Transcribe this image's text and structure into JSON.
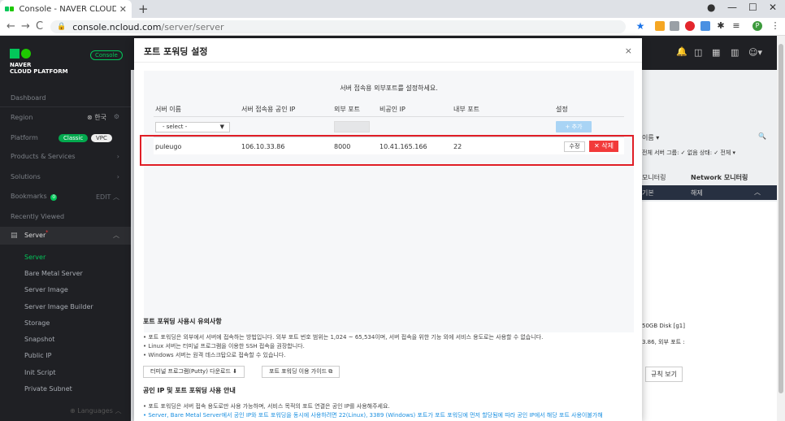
{
  "browser": {
    "tab_title": "Console - NAVER CLOUD PLATF",
    "url_host": "console.ncloud.com",
    "url_path": "/server/server",
    "new_tab": "+",
    "tab_close": "✕",
    "back": "←",
    "forward": "→",
    "reload": "C",
    "minimize": "—",
    "maximize": "☐",
    "close": "✕",
    "profile_initial": "P"
  },
  "sidebar": {
    "logo_line1": "NAVER",
    "logo_line2": "CLOUD PLATFORM",
    "console_badge": "Console",
    "dashboard": "Dashboard",
    "region": "Region",
    "region_value": "한국",
    "platform": "Platform",
    "platform_classic": "Classic",
    "platform_vpc": "VPC",
    "products": "Products & Services",
    "solutions": "Solutions",
    "bookmarks": "Bookmarks",
    "bookmarks_count": "0",
    "bookmarks_edit": "EDIT",
    "recently_viewed": "Recently Viewed",
    "server_group": "Server",
    "sub_items": [
      "Server",
      "Bare Metal Server",
      "Server Image",
      "Server Image Builder",
      "Storage",
      "Snapshot",
      "Public IP",
      "Init Script",
      "Private Subnet"
    ],
    "languages": "Languages"
  },
  "background": {
    "col_name_partial": "이름",
    "filter_text_partial": "전체  서버 그룹: ✓ 없음  상태: ✓ 전체",
    "monitor_partial": "모니터링",
    "network_monitor": "Network 모니터링",
    "dark_row_left": "기본",
    "dark_row_right": "해제",
    "disk_text": "50GB Disk [g1]",
    "ip_text": "3.86, 외부 포트 :",
    "rule_btn": "규칙 보기"
  },
  "modal": {
    "title": "포트 포워딩 설정",
    "close": "×",
    "instruction": "서버 접속용 외부포트를 설정하세요.",
    "columns": {
      "server_name": "서버 이름",
      "public_ip": "서버 접속용 공인 IP",
      "external_port": "외부 포트",
      "private_ip": "비공인 IP",
      "internal_port": "내부 포트",
      "settings": "설정"
    },
    "select_placeholder": "- select -",
    "add_button": "+ 추가",
    "rows": [
      {
        "server_name": "puleugo",
        "public_ip": "106.10.33.86",
        "external_port": "8000",
        "private_ip": "10.41.165.166",
        "internal_port": "22",
        "edit_label": "수정",
        "delete_label": "✕ 삭제"
      }
    ],
    "notice_title": "포트 포워딩 사용시 유의사항",
    "notices": [
      "• 포트 포워딩은 외부에서 서버에 접속하는 방법입니다. 외부 포트 번호 범위는 1,024 ~ 65,534이며, 서버 접속을 위한 기능 외에 서비스 용도로는 사용할 수 없습니다.",
      "• Linux 서버는 터미널 프로그램을 이용한 SSH 접속을 권장합니다.",
      "• Windows 서버는 원격 데스크탑으로 접속할 수 있습니다."
    ],
    "putty_button": "터미널 프로그램(Putty) 다운로드 ⬇",
    "guide_button": "포트 포워딩 이용 가이드 ⧉",
    "notice_title2": "공인 IP 및 포트 포워딩 사용 안내",
    "notices2": [
      "• 포트 포워딩은 서버 접속 용도로만 사용 가능하며, 서비스 목적의 포트 연결은 공인 IP를 사용해주세요.",
      "• Server, Bare Metal Server에서 공인 IP와 포트 포워딩을 동시에 사용하려면 22(Linux), 3389 (Windows) 포트가 포트 포워딩에 먼저 할당됨에 따라 공인 IP에서 해당 포트 사용이불가해"
    ]
  }
}
